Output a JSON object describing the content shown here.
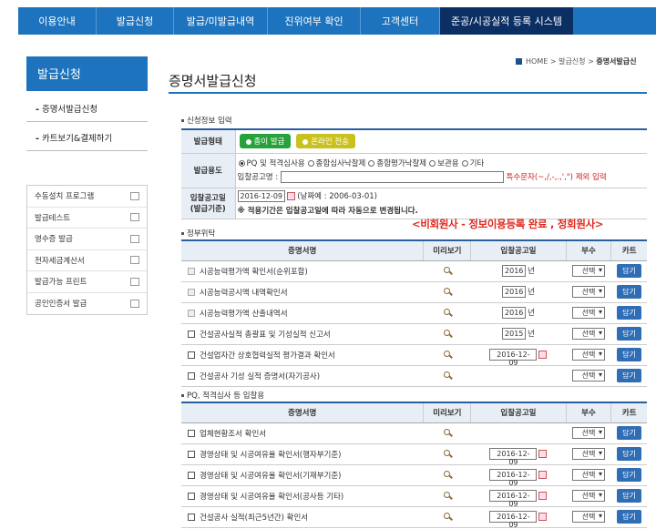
{
  "topnav": [
    "이용안내",
    "발급신청",
    "발급/미발급내역",
    "진위여부 확인",
    "고객센터",
    "준공/시공실적 등록 시스템"
  ],
  "sidebar": {
    "title": "발급신청",
    "menu": [
      {
        "dash": "-",
        "label": "증명서발급신청"
      },
      {
        "dash": "-",
        "label": "카트보기&결제하기"
      }
    ],
    "quick": [
      "수동설치 프로그램",
      "발급테스트",
      "영수증 발급",
      "전자세금계산서",
      "발급가능 프린트",
      "공인인증서 발급"
    ],
    "quick_icons": [
      "download-icon",
      "document-icon",
      "receipt-icon",
      "tax-invoice-icon",
      "printer-icon",
      "certificate-icon"
    ]
  },
  "breadcrumb": {
    "home": "HOME",
    "sep1": ">",
    "mid": "발급신청",
    "sep2": ">",
    "current": "증명서발급신"
  },
  "page_title": "증명서발급신청",
  "section_info": "신청정보 입력",
  "info": {
    "form_label": "발급형태",
    "paper": "종이 발급",
    "online": "온라인 전송",
    "usage_label": "발급용도",
    "usage_options": [
      "PQ 및 적격심사용",
      "종합심사낙찰제",
      "종합평가낙찰제",
      "보관용",
      "기타"
    ],
    "bid_name_label": "입찰공고명 :",
    "special_note": "특수문자(~,/,-,.,',\") 제외 입력",
    "date_label": "입찰공고일",
    "date_sub": "(발급기준)",
    "date_value": "2016-12-09",
    "date_example": "(날짜예 : 2006-03-01)",
    "date_note": "※ 적용기간은 입찰공고일에 따라 자동으로 변경됩니다."
  },
  "annotation": "<비회원사 - 정보이용등록 완료 , 정회원사>",
  "section_gov": "정부위탁",
  "columns": {
    "name": "증명서명",
    "preview": "미리보기",
    "date": "입찰공고일",
    "copies": "부수",
    "cart": "카트"
  },
  "gov_rows": [
    {
      "name": "시공능력평가액 확인서(순위포함)",
      "disabled": true,
      "date_type": "year",
      "year": "2016",
      "year_suffix": "년"
    },
    {
      "name": "시공능력공시액 내역확인서",
      "disabled": true,
      "date_type": "year",
      "year": "2016",
      "year_suffix": "년"
    },
    {
      "name": "시공능력평가액 산출내역서",
      "disabled": true,
      "date_type": "year",
      "year": "2016",
      "year_suffix": "년"
    },
    {
      "name": "건설공사실적 총괄표 및 기성실적 신고서",
      "disabled": false,
      "date_type": "year",
      "year": "2015",
      "year_suffix": "년"
    },
    {
      "name": "건설업자간 상호협력실적 평가결과 확인서",
      "disabled": false,
      "date_type": "date",
      "date": "2016-12-09"
    },
    {
      "name": "건설공사 기성 실적 증명서(자기공사)",
      "disabled": false,
      "date_type": "none"
    }
  ],
  "section_pq": "PQ, 적격심사 등 입찰용",
  "pq_rows": [
    {
      "name": "업체현황조서 확인서",
      "disabled": false,
      "date_type": "none"
    },
    {
      "name": "경영상태 및 시공여유율 확인서(행자부기준)",
      "disabled": false,
      "date_type": "date",
      "date": "2016-12-09"
    },
    {
      "name": "경영상태 및 시공여유율 확인서(기재부기준)",
      "disabled": false,
      "date_type": "date",
      "date": "2016-12-09"
    },
    {
      "name": "경영상태 및 시공여유율 확인서(공사등 기타)",
      "disabled": false,
      "date_type": "date",
      "date": "2016-12-09"
    },
    {
      "name": "건설공사 실적(최근5년간) 확인서",
      "disabled": false,
      "date_type": "date",
      "date": "2016-12-09"
    }
  ],
  "select_label": "선택",
  "cart_label": "담기"
}
